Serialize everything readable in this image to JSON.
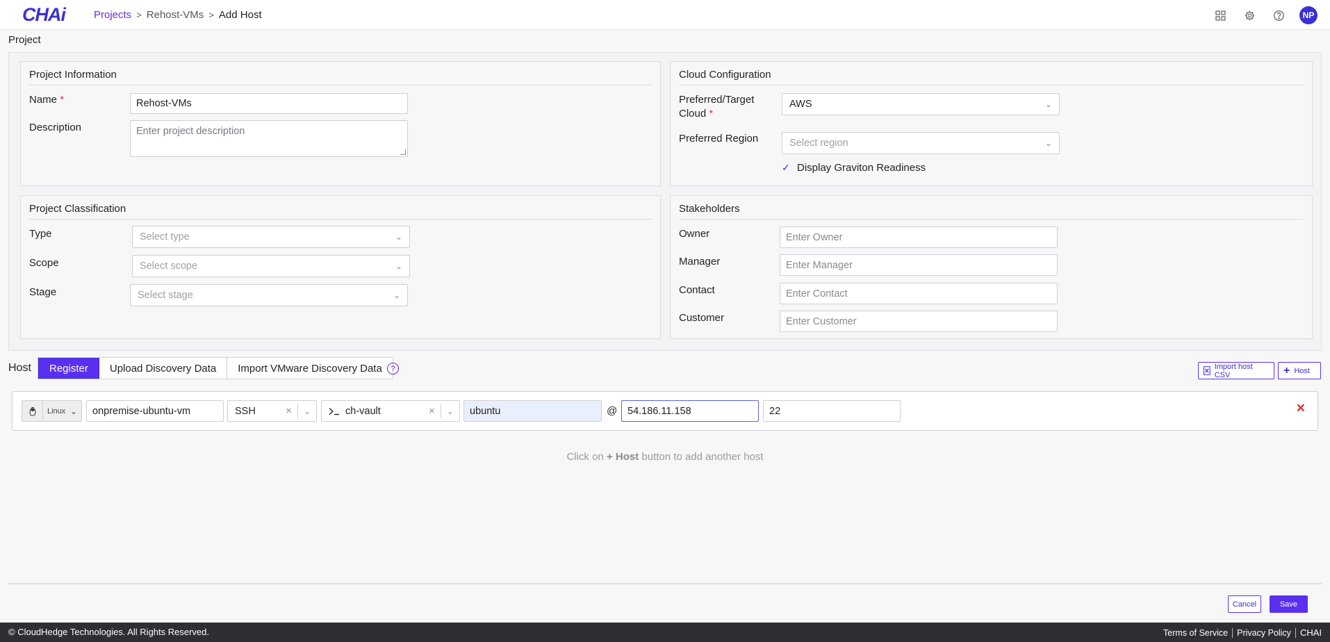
{
  "header": {
    "logo_text": "CHAi",
    "breadcrumb": {
      "projects": "Projects",
      "separator": ">",
      "project": "Rehost-VMs",
      "current": "Add Host"
    },
    "user_initials": "NP"
  },
  "page_title": "Project",
  "project_info": {
    "title": "Project Information",
    "name_label": "Name",
    "required_mark": "*",
    "name_value": "Rehost-VMs",
    "description_label": "Description",
    "description_placeholder": "Enter project description"
  },
  "cloud_config": {
    "title": "Cloud Configuration",
    "target_cloud_label_1": "Preferred/Target",
    "target_cloud_label_2": "Cloud",
    "target_cloud_value": "AWS",
    "region_label": "Preferred Region",
    "region_placeholder": "Select region",
    "graviton_label": "Display Graviton Readiness",
    "graviton_checked": true
  },
  "classification": {
    "title": "Project Classification",
    "type_label": "Type",
    "type_placeholder": "Select type",
    "scope_label": "Scope",
    "scope_placeholder": "Select scope",
    "stage_label": "Stage",
    "stage_placeholder": "Select stage"
  },
  "stakeholders": {
    "title": "Stakeholders",
    "owner_label": "Owner",
    "owner_placeholder": "Enter Owner",
    "manager_label": "Manager",
    "manager_placeholder": "Enter Manager",
    "contact_label": "Contact",
    "contact_placeholder": "Enter Contact",
    "customer_label": "Customer",
    "customer_placeholder": "Enter Customer"
  },
  "host": {
    "label": "Host",
    "tabs": [
      {
        "label": "Register",
        "active": true
      },
      {
        "label": "Upload Discovery Data",
        "active": false
      },
      {
        "label": "Import VMware Discovery Data",
        "active": false
      }
    ],
    "help": "?",
    "import_csv_label": "Import host CSV",
    "add_host_label": "Host",
    "row": {
      "os": "Linux",
      "hostname": "onpremise-ubuntu-vm",
      "protocol": "SSH",
      "credential": "ch-vault",
      "username": "ubuntu",
      "at": "@",
      "ip": "54.186.11.158",
      "port": "22"
    },
    "hint_prefix": "Click on",
    "hint_button": "+ Host",
    "hint_suffix": "button to add another host"
  },
  "actions": {
    "cancel": "Cancel",
    "save": "Save"
  },
  "footer": {
    "copyright": "© CloudHedge Technologies. All Rights Reserved.",
    "terms": "Terms of Service",
    "privacy": "Privacy Policy",
    "brand": "CHAI"
  },
  "colors": {
    "accent": "#5b2ff0",
    "brand": "#3b2fd6",
    "danger": "#e0303a",
    "footer_bg": "#2e2e33"
  }
}
